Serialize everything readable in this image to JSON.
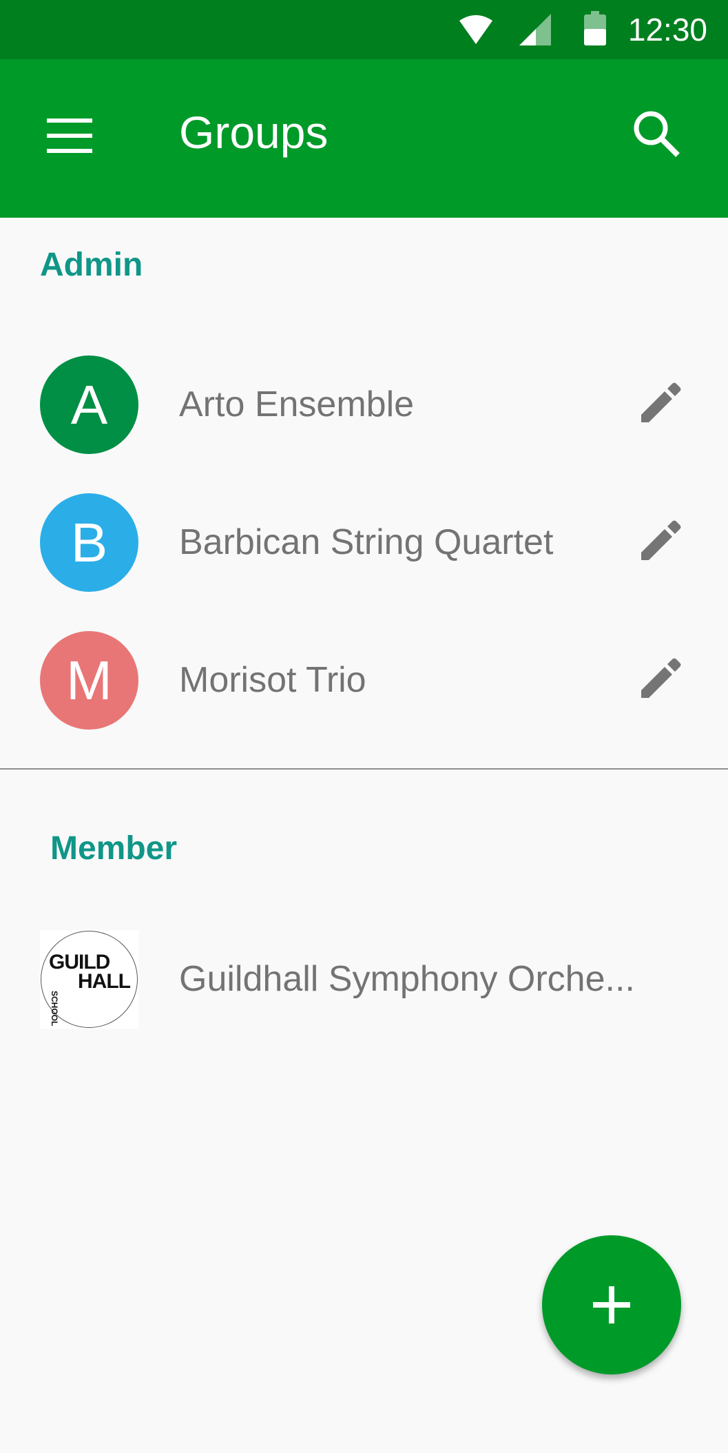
{
  "status_bar": {
    "time": "12:30",
    "icons": [
      "wifi-icon",
      "cellular-signal-icon",
      "battery-icon"
    ]
  },
  "app_bar": {
    "title": "Groups",
    "icons": [
      "menu-icon",
      "search-icon"
    ],
    "color": "#009a29"
  },
  "admin": {
    "header": "Admin",
    "groups": [
      {
        "initial": "A",
        "name": "Arto Ensemble",
        "color": "#008f45"
      },
      {
        "initial": "B",
        "name": "Barbican String Quartet",
        "color": "#2baee8"
      },
      {
        "initial": "M",
        "name": "Morisot Trio",
        "color": "#e87676"
      }
    ]
  },
  "member": {
    "header": "Member",
    "groups": [
      {
        "logo": "GUILDHALL SCHOOL",
        "name": "Guildhall Symphony Orche..."
      }
    ]
  },
  "fab": {
    "icon": "plus-icon",
    "color": "#009a29"
  }
}
